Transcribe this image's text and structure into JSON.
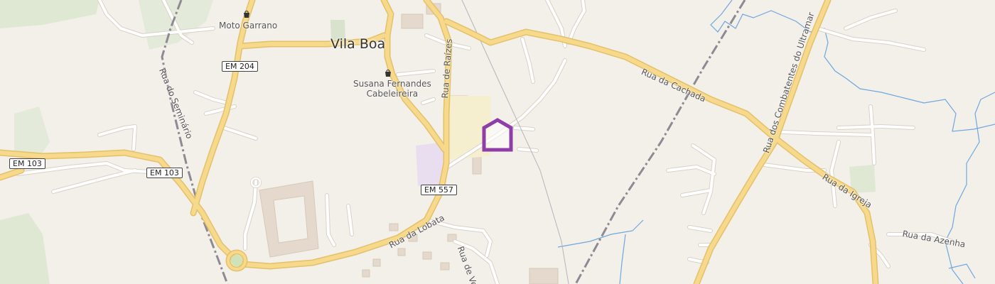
{
  "place": {
    "name": "Vila Boa"
  },
  "pois": [
    {
      "name": "Moto Garrano",
      "icon": "shop-bag-icon"
    },
    {
      "name_line1": "Susana Fernandes",
      "name_line2": "Cabeleireira",
      "icon": "shop-bag-icon"
    }
  ],
  "streets": {
    "raizes": "Rua de Raízes",
    "cachada": "Rua da Cachada",
    "combatentes": "Rua dos Combatentes do Ultramar",
    "igreja": "Rua da Igreja",
    "azenha": "Rua da Azenha",
    "lobata": "Rua da Lobata",
    "seminario": "Rua do Seminário",
    "ve": "Rua de Ve"
  },
  "shields": {
    "en204": "EM 204",
    "em103a": "EM 103",
    "em103b": "EM 103",
    "em557": "EM 557"
  },
  "marker": {
    "icon": "home-marker-icon",
    "color": "#8e3ea6"
  },
  "colors": {
    "background": "#f3efe9",
    "major_road": "#f6d98a",
    "major_road_casing": "#e4c06a",
    "minor_road": "#ffffff",
    "minor_road_casing": "#d8d2c8",
    "railway": "#8e8a94",
    "water": "#6fa7e0",
    "park": "#dfe8d3",
    "building": "#e4d9cc"
  }
}
